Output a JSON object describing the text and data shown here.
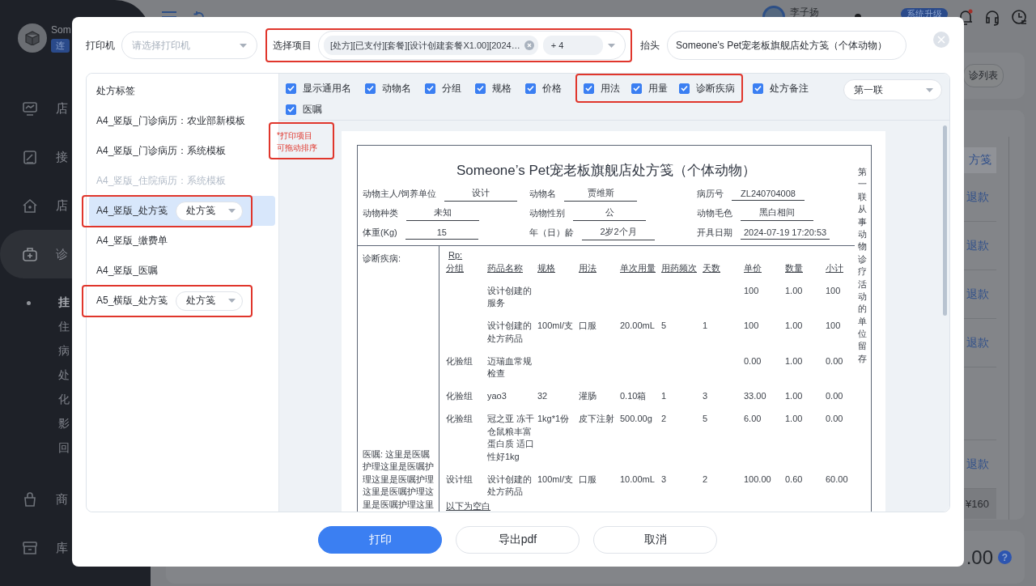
{
  "background": {
    "sidebar": {
      "user_name": "Som",
      "user_badge": "连",
      "items": [
        {
          "label": "店",
          "active": false
        },
        {
          "label": "接",
          "active": false
        },
        {
          "label": "店",
          "active": false
        },
        {
          "label": "诊",
          "active": true,
          "children": [
            {
              "label": "挂",
              "selected": true
            },
            {
              "label": "住",
              "selected": false
            },
            {
              "label": "病",
              "selected": false
            },
            {
              "label": "处",
              "selected": false
            },
            {
              "label": "化",
              "selected": false
            },
            {
              "label": "影",
              "selected": false
            },
            {
              "label": "回",
              "selected": false
            }
          ]
        },
        {
          "label": "商",
          "active": false
        },
        {
          "label": "库",
          "active": false
        }
      ]
    },
    "topbar": {
      "user_name": "李子扬",
      "upgrade_badge": "系统升级"
    },
    "list_button": "诊列表",
    "table_header": "方笺",
    "rows": [
      {
        "kind": "refund",
        "action": "退款"
      },
      {
        "kind": "refund",
        "action": "退款"
      },
      {
        "kind": "refund",
        "action": "退款"
      },
      {
        "kind": "refund",
        "action": "退款"
      },
      {
        "kind": "blank"
      },
      {
        "kind": "refund",
        "action": "退款"
      },
      {
        "kind": "total",
        "amount": "¥160"
      }
    ],
    "amount": ".00",
    "help": "?"
  },
  "dialog": {
    "printer": {
      "label": "打印机",
      "placeholder": "请选择打印机"
    },
    "items_select": {
      "label": "选择项目",
      "highlighted": true,
      "tags": [
        {
          "text": "[处方][已支付][套餐][设计创建套餐X1.00][2024…",
          "removable": true
        },
        {
          "text": "+ 4",
          "removable": false
        }
      ]
    },
    "header_field": {
      "label": "抬头",
      "value": "Someone’s Pet宠老板旗舰店处方笺（个体动物）"
    },
    "templates": [
      {
        "label": "处方标签",
        "selected": false,
        "disabled": false,
        "highlighted": false
      },
      {
        "label": "A4_竖版_门诊病历：农业部新模板",
        "selected": false,
        "disabled": false,
        "highlighted": false
      },
      {
        "label": "A4_竖版_门诊病历：系统模板",
        "selected": false,
        "disabled": false,
        "highlighted": false
      },
      {
        "label": "A4_竖版_住院病历：系统模板",
        "selected": false,
        "disabled": true,
        "highlighted": false
      },
      {
        "label": "A4_竖版_处方笺",
        "selected": true,
        "disabled": false,
        "highlighted": true,
        "format": "处方笺"
      },
      {
        "label": "A4_竖版_缴费单",
        "selected": false,
        "disabled": false,
        "highlighted": false
      },
      {
        "label": "A4_竖版_医嘱",
        "selected": false,
        "disabled": false,
        "highlighted": false
      },
      {
        "label": "A5_横版_处方笺",
        "selected": false,
        "disabled": false,
        "highlighted": true,
        "format": "处方笺"
      }
    ],
    "options": [
      {
        "label": "显示通用名",
        "checked": true,
        "highlighted": false
      },
      {
        "label": "动物名",
        "checked": true,
        "highlighted": false
      },
      {
        "label": "分组",
        "checked": true,
        "highlighted": false
      },
      {
        "label": "规格",
        "checked": true,
        "highlighted": false
      },
      {
        "label": "价格",
        "checked": true,
        "highlighted": false
      },
      {
        "label": "用法",
        "checked": true,
        "highlighted": true
      },
      {
        "label": "用量",
        "checked": true,
        "highlighted": true
      },
      {
        "label": "诊断疾病",
        "checked": true,
        "highlighted": true
      },
      {
        "label": "处方备注",
        "checked": true,
        "highlighted": false
      },
      {
        "label": "医嘱",
        "checked": true,
        "highlighted": false
      }
    ],
    "copy_select": "第一联",
    "drag_note": {
      "lines": [
        "*打印项目",
        "可拖动排序"
      ],
      "highlighted": true
    },
    "document": {
      "title": "Someone’s Pet宠老板旗舰店处方笺（个体动物）",
      "side_note": "第一联从事动物诊疗活动的单位留存",
      "fields": [
        {
          "label": "动物主人/饲养单位",
          "value": "设计"
        },
        {
          "label": "动物名",
          "value": "贾维斯"
        },
        {
          "label": "病历号",
          "value": "ZL240704008"
        },
        {
          "label": "动物种类",
          "value": "未知"
        },
        {
          "label": "动物性别",
          "value": "公"
        },
        {
          "label": "动物毛色",
          "value": "黑白相间"
        },
        {
          "label": "体重(Kg)",
          "value": "15"
        },
        {
          "label": "年（日）龄",
          "value": "2岁2个月"
        },
        {
          "label": "开具日期",
          "value": "2024-07-19 17:20:53"
        }
      ],
      "diagnosis_label": "诊断疾病:",
      "advice": "医嘱: 这里是医嘱护理这里是医嘱护理这里是医嘱护理这里是医嘱护理这里是医嘱护理这里",
      "rp": "Rp:",
      "columns": [
        "分组",
        "药品名称",
        "规格",
        "用法",
        "单次用量",
        "用药频次",
        "天数",
        "单价",
        "数量",
        "小计"
      ],
      "rows": [
        [
          null,
          "设计创建的服务",
          null,
          null,
          null,
          null,
          null,
          "100",
          "1.00",
          "100"
        ],
        [
          null,
          "设计创建的处方药品",
          "100ml/支",
          "口服",
          "20.00mL",
          "5",
          "1",
          "100",
          "1.00",
          "100"
        ],
        [
          "化验组",
          "迈瑞血常规检查",
          null,
          null,
          null,
          null,
          null,
          "0.00",
          "1.00",
          "0.00"
        ],
        [
          "化验组",
          "yao3",
          "32",
          "灌肠",
          "0.10箱",
          "1",
          "3",
          "33.00",
          "1.00",
          "0.00"
        ],
        [
          "化验组",
          "冠之亚 冻干仓鼠粮丰富蛋白质 适口性好1kg",
          "1kg*1份",
          "皮下注射",
          "500.00g",
          "2",
          "5",
          "6.00",
          "1.00",
          "0.00"
        ],
        [
          "设计组",
          "设计创建的处方药品",
          "100ml/支",
          "口服",
          "10.00mL",
          "3",
          "2",
          "100.00",
          "0.60",
          "60.00"
        ]
      ],
      "end_note": "以下为空白"
    },
    "buttons": [
      {
        "label": "打印",
        "kind": "primary"
      },
      {
        "label": "导出pdf",
        "kind": "default"
      },
      {
        "label": "取消",
        "kind": "default"
      }
    ]
  }
}
